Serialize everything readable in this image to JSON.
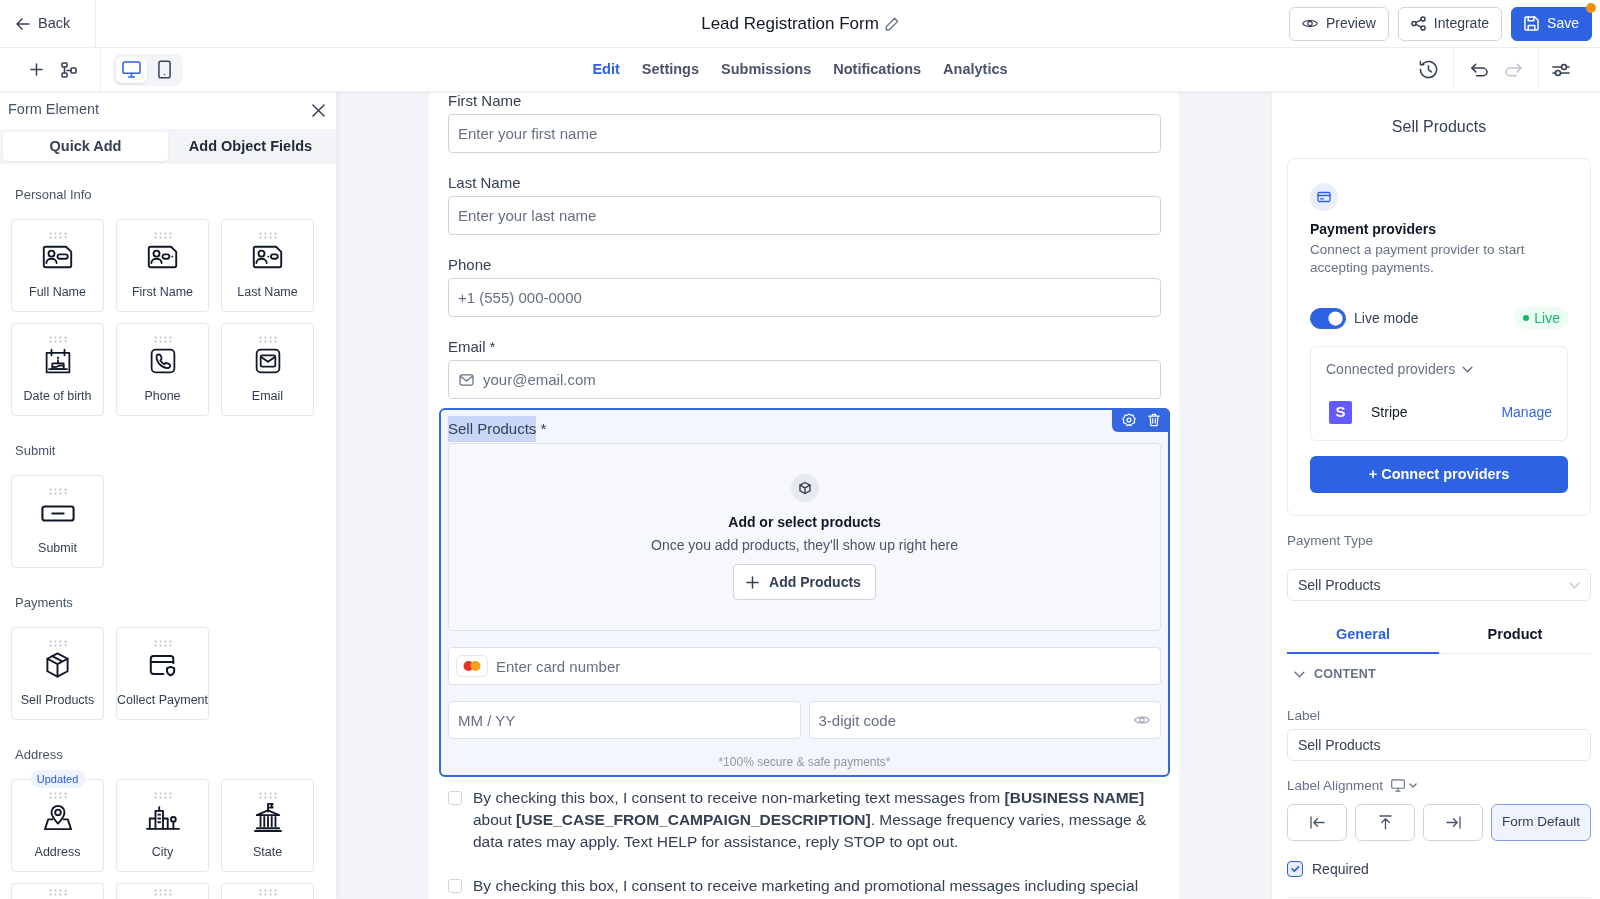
{
  "header": {
    "back_label": "Back",
    "title": "Lead Registration Form",
    "actions": [
      {
        "kind": "preview",
        "label": "Preview",
        "notification": false
      },
      {
        "kind": "integrate",
        "label": "Integrate",
        "notification": false
      },
      {
        "kind": "save",
        "label": "Save",
        "notification": true
      }
    ]
  },
  "toolbar": {
    "devices": [
      {
        "kind": "desktop",
        "selected": true
      },
      {
        "kind": "mobile",
        "selected": false
      }
    ],
    "tabs": [
      {
        "label": "Edit",
        "selected": true
      },
      {
        "label": "Settings",
        "selected": false
      },
      {
        "label": "Submissions",
        "selected": false
      },
      {
        "label": "Notifications",
        "selected": false
      },
      {
        "label": "Analytics",
        "selected": false
      }
    ],
    "history": [
      {
        "kind": "undo",
        "disabled": false
      },
      {
        "kind": "redo",
        "disabled": true
      }
    ]
  },
  "elements_panel": {
    "title": "Form Element",
    "tabs": [
      {
        "label": "Quick Add",
        "selected": true
      },
      {
        "label": "Add Object Fields",
        "selected": false
      }
    ],
    "sections": [
      {
        "title": "Personal Info",
        "items": [
          {
            "kind": "fullname",
            "label": "Full Name"
          },
          {
            "kind": "firstname",
            "label": "First Name"
          },
          {
            "kind": "lastname",
            "label": "Last Name"
          },
          {
            "kind": "birthday",
            "label": "Date of birth"
          },
          {
            "kind": "phone",
            "label": "Phone"
          },
          {
            "kind": "email",
            "label": "Email"
          }
        ]
      },
      {
        "title": "Submit",
        "items": [
          {
            "kind": "submit",
            "label": "Submit"
          }
        ]
      },
      {
        "title": "Payments",
        "items": [
          {
            "kind": "products",
            "label": "Sell Products"
          },
          {
            "kind": "payment",
            "label": "Collect Payment"
          }
        ]
      },
      {
        "title": "Address",
        "items": [
          {
            "kind": "address",
            "label": "Address",
            "badge": "Updated"
          },
          {
            "kind": "city",
            "label": "City"
          },
          {
            "kind": "state",
            "label": "State"
          },
          {
            "kind": "partial"
          },
          {
            "kind": "partial"
          },
          {
            "kind": "partial"
          }
        ]
      }
    ]
  },
  "form": {
    "fields": [
      {
        "kind": "text",
        "label": "First Name",
        "placeholder": "Enter your first name",
        "selected": false
      },
      {
        "kind": "text",
        "label": "Last Name",
        "placeholder": "Enter your last name",
        "selected": false
      },
      {
        "kind": "text",
        "label": "Phone",
        "placeholder": "+1 (555) 000-0000",
        "selected": false
      },
      {
        "kind": "email",
        "label": "Email",
        "required_mark": "*",
        "placeholder": "your@email.com",
        "selected": false
      },
      {
        "kind": "products",
        "label": "Sell Products",
        "required_mark": "*",
        "selected": true,
        "empty_title": "Add or select products",
        "empty_text": "Once you add products, they'll show up right here",
        "add_button": "Add Products",
        "card_placeholder": "Enter card number",
        "expiry_placeholder": "MM / YY",
        "cvc_placeholder": "3-digit code",
        "note": "*100% secure & safe payments*"
      },
      {
        "kind": "consent",
        "checked": false,
        "selected": false,
        "text": "By checking this box, I consent to receive non-marketing text messages from **[BUSINESS NAME]** about **[USE_CASE_FROM_CAMPAIGN_DESCRIPTION]**. Message frequency varies, message & data rates may apply. Text HELP for assistance, reply STOP to opt out."
      },
      {
        "kind": "consent",
        "checked": false,
        "selected": false,
        "text": "By checking this box, I consent to receive marketing and promotional messages including special"
      }
    ]
  },
  "settings_panel": {
    "title": "Sell Products",
    "providers": {
      "title": "Payment providers",
      "description": "Connect a payment provider to start accepting payments.",
      "live_mode": {
        "label": "Live mode",
        "on": true
      },
      "status": "Live",
      "connected": {
        "title": "Connected providers",
        "expanded": true,
        "items": [
          {
            "logo": "S",
            "name": "Stripe",
            "action": "Manage"
          }
        ]
      },
      "connect_button": "+ Connect providers"
    },
    "payment_type": {
      "label": "Payment Type",
      "value": "Sell Products"
    },
    "tabs": [
      {
        "label": "General",
        "selected": true
      },
      {
        "label": "Product",
        "selected": false
      }
    ],
    "section": {
      "title": "CONTENT",
      "expanded": true
    },
    "label_field": {
      "label": "Label",
      "value": "Sell Products"
    },
    "alignment": {
      "label": "Label Alignment",
      "options": [
        {
          "kind": "left",
          "selected": false
        },
        {
          "kind": "top",
          "selected": false
        },
        {
          "kind": "right",
          "selected": false
        },
        {
          "kind": "default",
          "label": "Form Default",
          "selected": true
        }
      ]
    },
    "required": {
      "label": "Required",
      "checked": true
    }
  }
}
